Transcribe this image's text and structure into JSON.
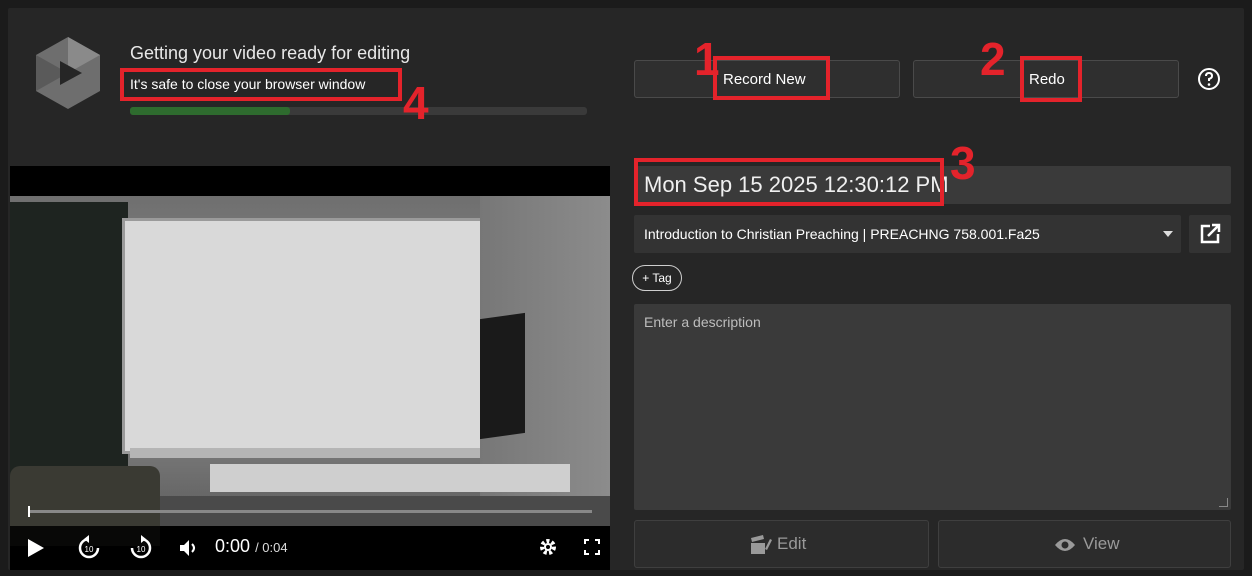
{
  "status": {
    "title": "Getting your video ready for editing",
    "subtitle": "It's safe to close your browser window",
    "progress_fraction": 0.35
  },
  "toolbar": {
    "record_new_label": "Record New",
    "redo_label": "Redo"
  },
  "player": {
    "current_time": "0:00",
    "duration": "/ 0:04",
    "skip_back_label": "10",
    "skip_forward_label": "10"
  },
  "session": {
    "title": "Mon Sep 15 2025 12:30:12 PM",
    "folder": "Introduction to Christian Preaching | PREACHNG 758.001.Fa25",
    "tag_label": "+ Tag",
    "description_placeholder": "Enter a description"
  },
  "actions": {
    "edit_label": "Edit",
    "view_label": "View"
  },
  "annotations": [
    "1",
    "2",
    "3",
    "4"
  ],
  "colors": {
    "annotation_red": "#e4232b",
    "progress_green": "#2e6b2e",
    "background": "#262626"
  }
}
